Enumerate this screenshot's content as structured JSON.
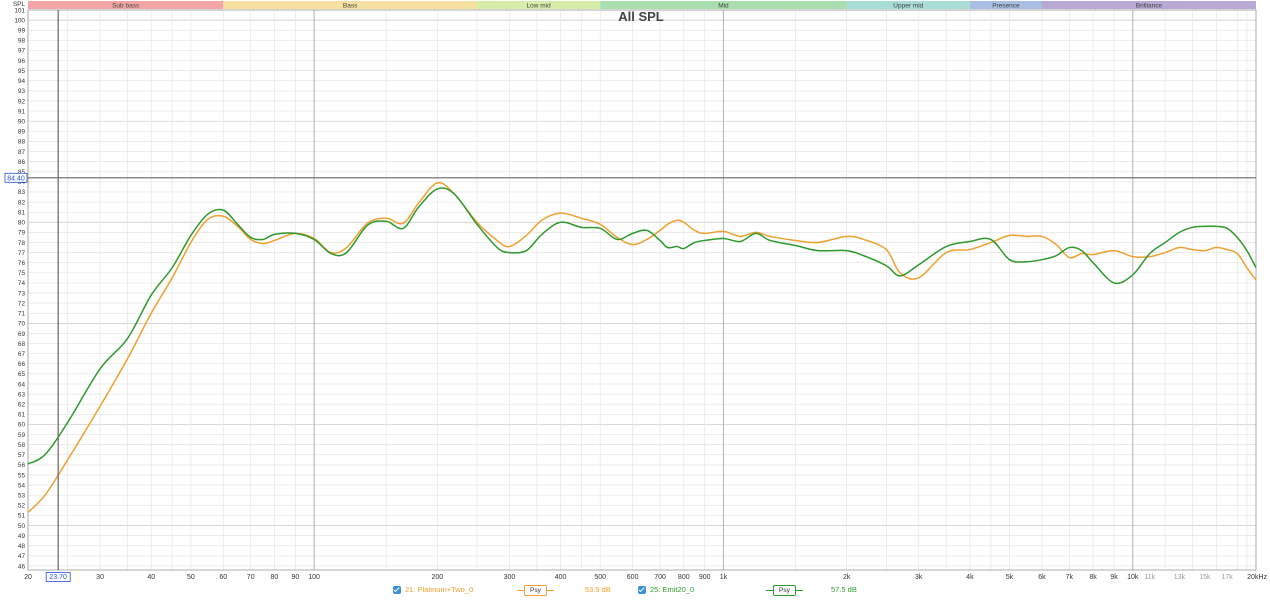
{
  "chart_data": {
    "type": "line",
    "title": "All SPL",
    "ylabel": "SPL",
    "xscale": "log",
    "xlim": [
      20,
      20000
    ],
    "ylim": [
      45.6,
      101
    ],
    "x_ticks": [
      {
        "v": 20,
        "label": "20"
      },
      {
        "v": 30,
        "label": "30"
      },
      {
        "v": 40,
        "label": "40"
      },
      {
        "v": 50,
        "label": "50"
      },
      {
        "v": 60,
        "label": "60"
      },
      {
        "v": 70,
        "label": "70"
      },
      {
        "v": 80,
        "label": "80"
      },
      {
        "v": 90,
        "label": "90"
      },
      {
        "v": 100,
        "label": "100"
      },
      {
        "v": 200,
        "label": "200"
      },
      {
        "v": 300,
        "label": "300"
      },
      {
        "v": 400,
        "label": "400"
      },
      {
        "v": 500,
        "label": "500"
      },
      {
        "v": 600,
        "label": "600"
      },
      {
        "v": 700,
        "label": "700"
      },
      {
        "v": 800,
        "label": "800"
      },
      {
        "v": 900,
        "label": "900"
      },
      {
        "v": 1000,
        "label": "1k"
      },
      {
        "v": 2000,
        "label": "2k"
      },
      {
        "v": 3000,
        "label": "3k"
      },
      {
        "v": 4000,
        "label": "4k"
      },
      {
        "v": 5000,
        "label": "5k"
      },
      {
        "v": 6000,
        "label": "6k"
      },
      {
        "v": 7000,
        "label": "7k"
      },
      {
        "v": 8000,
        "label": "8k"
      },
      {
        "v": 9000,
        "label": "9k"
      },
      {
        "v": 10000,
        "label": "10k"
      },
      {
        "v": 11000,
        "label": "11k"
      },
      {
        "v": 13000,
        "label": "13k"
      },
      {
        "v": 15000,
        "label": "15k"
      },
      {
        "v": 17000,
        "label": "17k"
      },
      {
        "v": 20000,
        "label": "20kHz"
      }
    ],
    "y_ticks": [
      46,
      47,
      48,
      49,
      50,
      51,
      52,
      53,
      54,
      55,
      56,
      57,
      58,
      59,
      60,
      61,
      62,
      63,
      64,
      65,
      66,
      67,
      68,
      69,
      70,
      71,
      72,
      73,
      74,
      75,
      76,
      77,
      78,
      79,
      80,
      81,
      82,
      83,
      84,
      85,
      86,
      87,
      88,
      89,
      90,
      91,
      92,
      93,
      94,
      95,
      96,
      97,
      98,
      99,
      100,
      101
    ],
    "bands": [
      {
        "name": "Sub bass",
        "from": 20,
        "to": 60,
        "color": "#f4a6a6"
      },
      {
        "name": "Bass",
        "from": 60,
        "to": 250,
        "color": "#f6e0a0"
      },
      {
        "name": "Low mid",
        "from": 250,
        "to": 500,
        "color": "#d6eda8"
      },
      {
        "name": "Mid",
        "from": 500,
        "to": 2000,
        "color": "#a9dfaf"
      },
      {
        "name": "Upper mid",
        "from": 2000,
        "to": 4000,
        "color": "#a8dcd6"
      },
      {
        "name": "Presence",
        "from": 4000,
        "to": 6000,
        "color": "#a8bfe3"
      },
      {
        "name": "Brilliance",
        "from": 6000,
        "to": 20000,
        "color": "#b9a8d4"
      }
    ],
    "cursor": {
      "x": 23.7,
      "x_label": "23.70",
      "y": 84.4,
      "y_label": "84.40"
    },
    "series": [
      {
        "name": "21: Platinum+Two_0",
        "color": "#f0a030",
        "smoothing": "Psy",
        "level": "53.9 dB",
        "x": [
          20,
          22,
          25,
          30,
          35,
          40,
          45,
          50,
          55,
          60,
          65,
          70,
          75,
          80,
          90,
          100,
          110,
          120,
          135,
          150,
          165,
          180,
          200,
          220,
          250,
          280,
          300,
          330,
          360,
          400,
          450,
          500,
          550,
          600,
          650,
          700,
          730,
          770,
          800,
          850,
          900,
          1000,
          1100,
          1200,
          1300,
          1500,
          1700,
          2000,
          2200,
          2500,
          2700,
          3000,
          3500,
          4000,
          4500,
          5000,
          5500,
          6000,
          6500,
          7000,
          7500,
          8000,
          9000,
          10000,
          11000,
          12000,
          13000,
          14000,
          15000,
          16000,
          17000,
          18000,
          19000,
          20000
        ],
        "values": [
          51.3,
          53.0,
          56.5,
          61.8,
          66.5,
          71.0,
          74.5,
          78.0,
          80.3,
          80.6,
          79.6,
          78.3,
          77.9,
          78.2,
          78.9,
          78.4,
          77.0,
          77.5,
          79.9,
          80.4,
          79.9,
          81.9,
          83.9,
          82.8,
          80.0,
          78.2,
          77.6,
          78.7,
          80.2,
          80.9,
          80.4,
          79.8,
          78.5,
          77.8,
          78.3,
          79.2,
          79.8,
          80.2,
          80.0,
          79.2,
          78.9,
          79.1,
          78.6,
          79.0,
          78.6,
          78.2,
          78.0,
          78.6,
          78.3,
          77.3,
          75.0,
          74.5,
          77.0,
          77.3,
          78.0,
          78.7,
          78.6,
          78.6,
          77.8,
          76.5,
          76.9,
          76.8,
          77.2,
          76.6,
          76.6,
          77.0,
          77.5,
          77.3,
          77.2,
          77.5,
          77.3,
          76.9,
          75.5,
          74.3
        ]
      },
      {
        "name": "25: Emit20_0",
        "color": "#2e9a2e",
        "smoothing": "Psy",
        "level": "57.5 dB",
        "x": [
          20,
          22,
          25,
          30,
          35,
          40,
          45,
          50,
          55,
          60,
          65,
          70,
          75,
          80,
          90,
          100,
          110,
          120,
          135,
          150,
          165,
          180,
          200,
          220,
          250,
          280,
          300,
          330,
          360,
          400,
          450,
          500,
          550,
          600,
          650,
          700,
          730,
          770,
          800,
          850,
          900,
          1000,
          1100,
          1200,
          1300,
          1500,
          1700,
          2000,
          2200,
          2500,
          2700,
          3000,
          3500,
          4000,
          4500,
          5000,
          5500,
          6000,
          6500,
          7000,
          7500,
          8000,
          9000,
          10000,
          11000,
          12000,
          13000,
          14000,
          15000,
          16000,
          17000,
          18000,
          19000,
          20000
        ],
        "values": [
          56.1,
          57.0,
          60.2,
          65.5,
          68.5,
          72.8,
          75.5,
          78.7,
          80.8,
          81.2,
          79.8,
          78.5,
          78.3,
          78.8,
          78.9,
          78.3,
          76.9,
          77.0,
          79.7,
          80.1,
          79.4,
          81.5,
          83.3,
          82.8,
          79.8,
          77.5,
          77.0,
          77.2,
          78.8,
          80.0,
          79.5,
          79.4,
          78.3,
          78.9,
          79.2,
          78.2,
          77.5,
          77.6,
          77.4,
          78.0,
          78.2,
          78.4,
          78.1,
          78.9,
          78.2,
          77.7,
          77.2,
          77.2,
          76.7,
          75.7,
          74.7,
          75.8,
          77.6,
          78.1,
          78.3,
          76.3,
          76.1,
          76.3,
          76.7,
          77.5,
          77.2,
          76.0,
          74.0,
          74.8,
          76.9,
          78.0,
          79.0,
          79.5,
          79.6,
          79.6,
          79.4,
          78.5,
          77.2,
          75.5
        ]
      }
    ]
  }
}
